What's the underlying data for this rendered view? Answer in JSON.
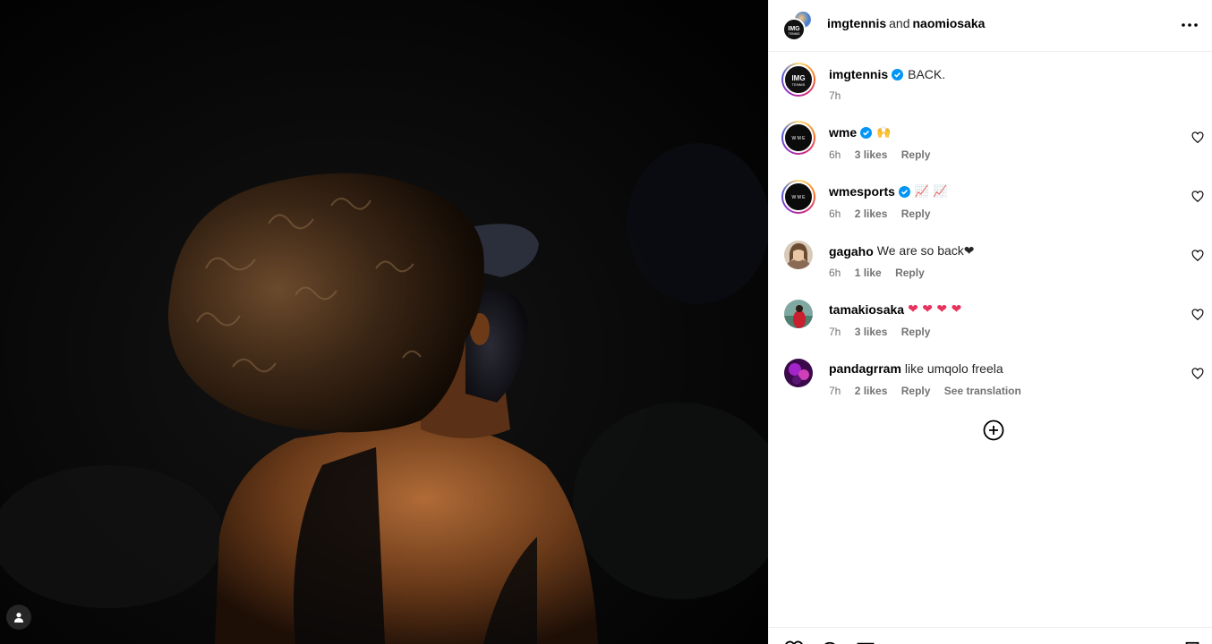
{
  "header": {
    "user1": "imgtennis",
    "conjunction": "and",
    "user2": "naomiosaka"
  },
  "caption": {
    "user": "imgtennis",
    "verified": true,
    "text": "BACK.",
    "time": "7h"
  },
  "comments": [
    {
      "user": "wme",
      "verified": true,
      "text": "🙌",
      "time": "6h",
      "likes": "3 likes",
      "reply": "Reply"
    },
    {
      "user": "wmesports",
      "verified": true,
      "text": "📈 📈",
      "time": "6h",
      "likes": "2 likes",
      "reply": "Reply"
    },
    {
      "user": "gagaho",
      "verified": false,
      "text": "We are so back❤",
      "time": "6h",
      "likes": "1 like",
      "reply": "Reply"
    },
    {
      "user": "tamakiosaka",
      "verified": false,
      "text": "❤ ❤ ❤ ❤",
      "time": "7h",
      "likes": "3 likes",
      "reply": "Reply"
    },
    {
      "user": "pandagrram",
      "verified": false,
      "text": "like umqolo freela",
      "time": "7h",
      "likes": "2 likes",
      "reply": "Reply",
      "translate": "See translation"
    }
  ],
  "avatar_logos": {
    "imgtennis": "IMG",
    "imgtennis_sub": "TENNIS",
    "wme": "W M E"
  },
  "colors": {
    "verified": "#0095f6",
    "heart": "#e8335c",
    "muted": "#737373"
  },
  "icons": {
    "more": "more-horizontal-icon",
    "like": "heart-outline-icon",
    "load": "plus-circle-icon",
    "tag": "user-tag-icon",
    "verified": "verified-badge-icon"
  }
}
